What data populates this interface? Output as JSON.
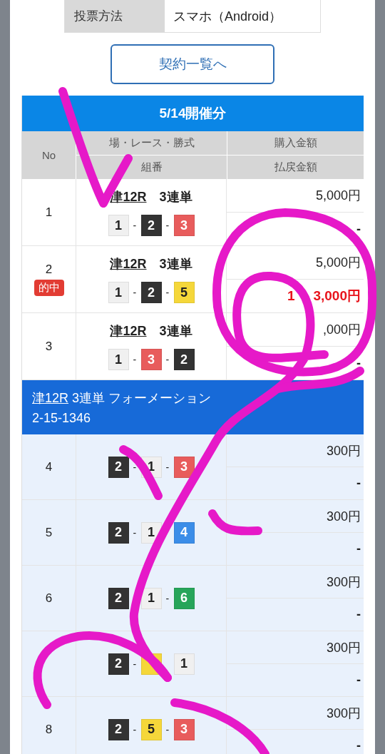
{
  "info": {
    "label": "投票方法",
    "value": "スマホ（Android）"
  },
  "button": "契約一覧へ",
  "date_header": "5/14開催分",
  "table": {
    "headers": {
      "no": "No",
      "race_top": "場・レース・勝式",
      "race_bottom": "組番",
      "amount_top": "購入金額",
      "amount_bottom": "払戻金額"
    },
    "groups": [
      {
        "kind": "plain",
        "rows": [
          {
            "no": "1",
            "race": "津12R",
            "bet_type": "3連単",
            "beads": [
              {
                "num": "1",
                "color": "#f0f0f0"
              },
              {
                "sep": "-",
                "num": "2",
                "color": "#333333"
              },
              {
                "sep": "-",
                "num": "3",
                "color": "#e85c5c"
              }
            ],
            "purchase": "5,000円",
            "payout": [
              "-"
            ],
            "hit": false
          },
          {
            "no": "2",
            "race": "津12R",
            "bet_type": "3連単",
            "beads": [
              {
                "num": "1",
                "color": "#f0f0f0"
              },
              {
                "sep": "-",
                "num": "2",
                "color": "#333333"
              },
              {
                "sep": "-",
                "num": "5",
                "color": "#f5d73a"
              }
            ],
            "purchase": "5,000円",
            "payout": [
              "1",
              "3,000円"
            ],
            "hit": true,
            "hit_label": "的中"
          },
          {
            "no": "3",
            "race": "津12R",
            "bet_type": "3連単",
            "beads": [
              {
                "num": "1",
                "color": "#f0f0f0"
              },
              {
                "sep": "-",
                "num": "3",
                "color": "#e85c5c"
              },
              {
                "sep": "-",
                "num": "2",
                "color": "#333333"
              }
            ],
            "purchase": ",000円",
            "payout": [
              "-"
            ],
            "hit": false
          }
        ]
      },
      {
        "kind": "formation",
        "title_link": "津12R",
        "title": "3連単 フォーメーション",
        "combo": "2-15-1346",
        "rows": [
          {
            "no": "4",
            "beads": [
              {
                "num": "2",
                "color": "#333333"
              },
              {
                "sep": "-",
                "num": "1",
                "color": "#f0f0f0"
              },
              {
                "sep": "-",
                "num": "3",
                "color": "#e85c5c"
              }
            ],
            "purchase": "300円",
            "payout": [
              "-"
            ],
            "hit": false
          },
          {
            "no": "5",
            "beads": [
              {
                "num": "2",
                "color": "#333333"
              },
              {
                "sep": "-",
                "num": "1",
                "color": "#f0f0f0"
              },
              {
                "num": "4",
                "color": "#3b8de8"
              }
            ],
            "purchase": "300円",
            "payout": [
              "-"
            ],
            "hit": false
          },
          {
            "no": "6",
            "beads": [
              {
                "num": "2",
                "color": "#333333"
              },
              {
                "num": "1",
                "color": "#f0f0f0"
              },
              {
                "sep": "-",
                "num": "6",
                "color": "#27a55a"
              }
            ],
            "purchase": "300円",
            "payout": [
              "-"
            ],
            "hit": false
          },
          {
            "beads": [
              {
                "num": "2",
                "color": "#333333"
              },
              {
                "sep": "-",
                "color": "#f5d73a"
              },
              {
                "num": "1",
                "color": "#f0f0f0"
              }
            ],
            "purchase": "300円",
            "payout": [
              "-"
            ],
            "hit": false
          },
          {
            "no": "8",
            "beads": [
              {
                "num": "2",
                "color": "#333333"
              },
              {
                "sep": "-",
                "num": "5",
                "color": "#f5d73a"
              },
              {
                "sep": "-",
                "num": "3",
                "color": "#e85c5c"
              }
            ],
            "purchase": "300円",
            "payout": [
              "-"
            ],
            "hit": false
          }
        ]
      }
    ]
  }
}
